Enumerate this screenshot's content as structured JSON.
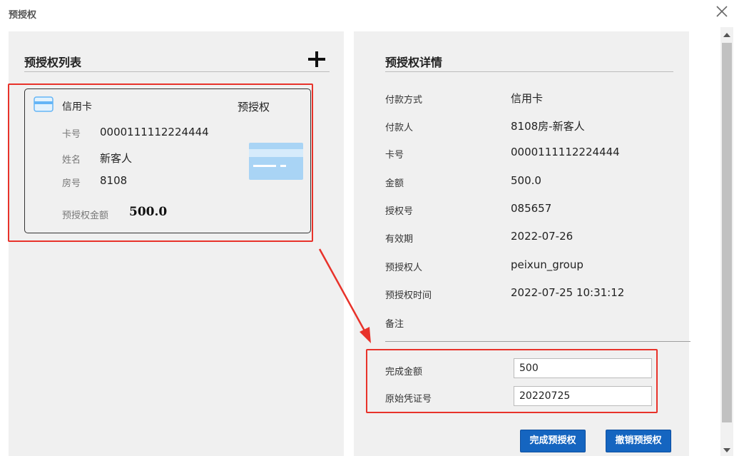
{
  "window": {
    "title": "预授权",
    "close_icon": "close-icon"
  },
  "left": {
    "heading": "预授权列表",
    "add_icon": "plus-icon",
    "card": {
      "type": "信用卡",
      "tag": "预授权",
      "card_no_label": "卡号",
      "card_no": "0000111112224444",
      "name_label": "姓名",
      "name": "新客人",
      "room_label": "房号",
      "room": "8108",
      "amount_label": "预授权金额",
      "amount": "500.0"
    }
  },
  "right": {
    "heading": "预授权详情",
    "details": [
      {
        "label": "付款方式",
        "value": "信用卡"
      },
      {
        "label": "付款人",
        "value": "8108房-新客人"
      },
      {
        "label": "卡号",
        "value": "0000111112224444"
      },
      {
        "label": "金额",
        "value": "500.0"
      },
      {
        "label": "授权号",
        "value": "085657"
      },
      {
        "label": "有效期",
        "value": "2022-07-26"
      },
      {
        "label": "预授权人",
        "value": "peixun_group"
      },
      {
        "label": "预授权时间",
        "value": "2022-07-25 10:31:12"
      },
      {
        "label": "备注",
        "value": ""
      }
    ],
    "form": {
      "complete_amount_label": "完成金额",
      "complete_amount_value": "500",
      "voucher_label": "原始凭证号",
      "voucher_value": "20220725"
    },
    "buttons": {
      "complete": "完成预授权",
      "cancel": "撤销预授权"
    }
  },
  "colors": {
    "accent": "#1565c0",
    "highlight": "#e8322a",
    "panel": "#f0f0f0",
    "card_icon": "#90caf9"
  }
}
